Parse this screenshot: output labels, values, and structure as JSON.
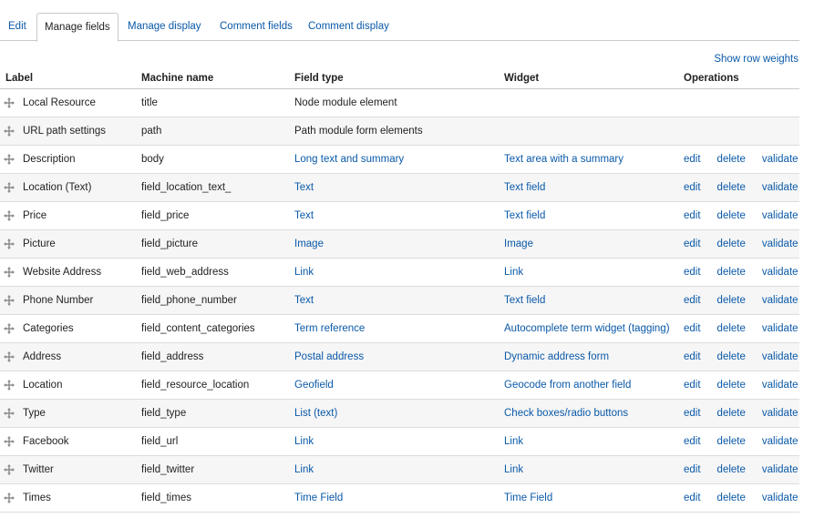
{
  "tabs": [
    {
      "label": "Edit",
      "active": false
    },
    {
      "label": "Manage fields",
      "active": true
    },
    {
      "label": "Manage display",
      "active": false
    },
    {
      "label": "Comment fields",
      "active": false
    },
    {
      "label": "Comment display",
      "active": false
    }
  ],
  "show_row_weights": "Show row weights",
  "columns": {
    "label": "Label",
    "machine_name": "Machine name",
    "field_type": "Field type",
    "widget": "Widget",
    "operations": "Operations"
  },
  "rows": [
    {
      "label": "Local Resource",
      "machine": "title",
      "type": "Node module element",
      "type_link": false,
      "widget": "",
      "ops": []
    },
    {
      "label": "URL path settings",
      "machine": "path",
      "type": "Path module form elements",
      "type_link": false,
      "widget": "",
      "ops": []
    },
    {
      "label": "Description",
      "machine": "body",
      "type": "Long text and summary",
      "type_link": true,
      "widget": "Text area with a summary",
      "ops": [
        "edit",
        "delete",
        "validate"
      ]
    },
    {
      "label": "Location (Text)",
      "machine": "field_location_text_",
      "type": "Text",
      "type_link": true,
      "widget": "Text field",
      "ops": [
        "edit",
        "delete",
        "validate"
      ]
    },
    {
      "label": "Price",
      "machine": "field_price",
      "type": "Text",
      "type_link": true,
      "widget": "Text field",
      "ops": [
        "edit",
        "delete",
        "validate"
      ]
    },
    {
      "label": "Picture",
      "machine": "field_picture",
      "type": "Image",
      "type_link": true,
      "widget": "Image",
      "ops": [
        "edit",
        "delete",
        "validate"
      ]
    },
    {
      "label": "Website Address",
      "machine": "field_web_address",
      "type": "Link",
      "type_link": true,
      "widget": "Link",
      "ops": [
        "edit",
        "delete",
        "validate"
      ]
    },
    {
      "label": "Phone Number",
      "machine": "field_phone_number",
      "type": "Text",
      "type_link": true,
      "widget": "Text field",
      "ops": [
        "edit",
        "delete",
        "validate"
      ]
    },
    {
      "label": "Categories",
      "machine": "field_content_categories",
      "type": "Term reference",
      "type_link": true,
      "widget": "Autocomplete term widget (tagging)",
      "ops": [
        "edit",
        "delete",
        "validate"
      ]
    },
    {
      "label": "Address",
      "machine": "field_address",
      "type": "Postal address",
      "type_link": true,
      "widget": "Dynamic address form",
      "ops": [
        "edit",
        "delete",
        "validate"
      ]
    },
    {
      "label": "Location",
      "machine": "field_resource_location",
      "type": "Geofield",
      "type_link": true,
      "widget": "Geocode from another field",
      "ops": [
        "edit",
        "delete",
        "validate"
      ]
    },
    {
      "label": "Type",
      "machine": "field_type",
      "type": "List (text)",
      "type_link": true,
      "widget": "Check boxes/radio buttons",
      "ops": [
        "edit",
        "delete",
        "validate"
      ]
    },
    {
      "label": "Facebook",
      "machine": "field_url",
      "type": "Link",
      "type_link": true,
      "widget": "Link",
      "ops": [
        "edit",
        "delete",
        "validate"
      ]
    },
    {
      "label": "Twitter",
      "machine": "field_twitter",
      "type": "Link",
      "type_link": true,
      "widget": "Link",
      "ops": [
        "edit",
        "delete",
        "validate"
      ]
    },
    {
      "label": "Times",
      "machine": "field_times",
      "type": "Time Field",
      "type_link": true,
      "widget": "Time Field",
      "ops": [
        "edit",
        "delete",
        "validate"
      ]
    }
  ],
  "colors": {
    "link": "#0a59a8",
    "text": "#222222",
    "row_alt": "#f6f6f6",
    "border": "#dcdcdc",
    "drag_icon": "#8a8a8a"
  }
}
